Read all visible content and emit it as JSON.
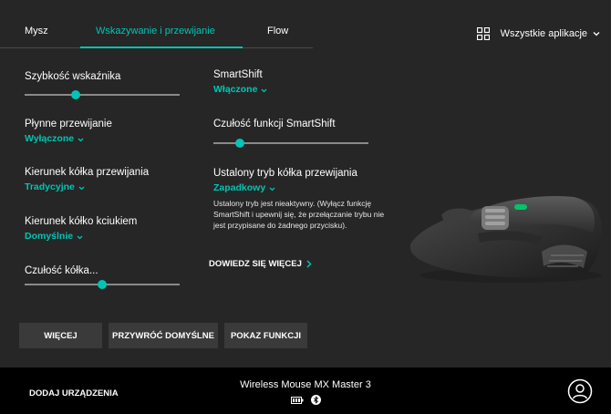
{
  "tabs": {
    "mouse": "Mysz",
    "pointing": "Wskazywanie i przewijanie",
    "flow": "Flow"
  },
  "apps_selector": {
    "label": "Wszystkie aplikacje",
    "icon": "grid-icon"
  },
  "settings": {
    "pointer_speed": {
      "label": "Szybkość wskaźnika",
      "level": 0.33
    },
    "smooth_scroll": {
      "label": "Płynne przewijanie",
      "value": "Wyłączone"
    },
    "wheel_direction": {
      "label": "Kierunek kółka przewijania",
      "value": "Tradycyjne"
    },
    "thumbwheel_direction": {
      "label": "Kierunek kółko kciukiem",
      "value": "Domyślnie"
    },
    "wheel_sensitivity": {
      "label": "Czułość kółka...",
      "level": 0.5
    },
    "smartshift": {
      "label": "SmartShift",
      "value": "Włączone"
    },
    "smartshift_sensitivity": {
      "label": "Czułość funkcji SmartShift",
      "level": 0.17
    },
    "fixed_mode": {
      "label": "Ustalony tryb kółka przewijania",
      "value": "Zapadkowy"
    },
    "fixed_mode_note": "Ustalony tryb jest nieaktywny. (Wyłącz funkcję SmartShift i upewnij się, że przełączanie trybu nie jest przypisane do żadnego przycisku)."
  },
  "learn_more": "DOWIEDZ SIĘ WIĘCEJ",
  "buttons": {
    "more": "WIĘCEJ",
    "restore_defaults": "PRZYWRÓĆ DOMYŚLNE",
    "show_features": "POKAZ FUNKCJI"
  },
  "footer": {
    "add_device": "DODAJ URZĄDZENIA",
    "device_name": "Wireless Mouse MX Master 3",
    "battery_icon": "battery-icon",
    "bluetooth_icon": "bluetooth-icon",
    "account_icon": "account-icon"
  },
  "colors": {
    "accent": "#00c4b4",
    "background": "#262626",
    "footer": "#000000",
    "button": "#3a3a3a"
  }
}
